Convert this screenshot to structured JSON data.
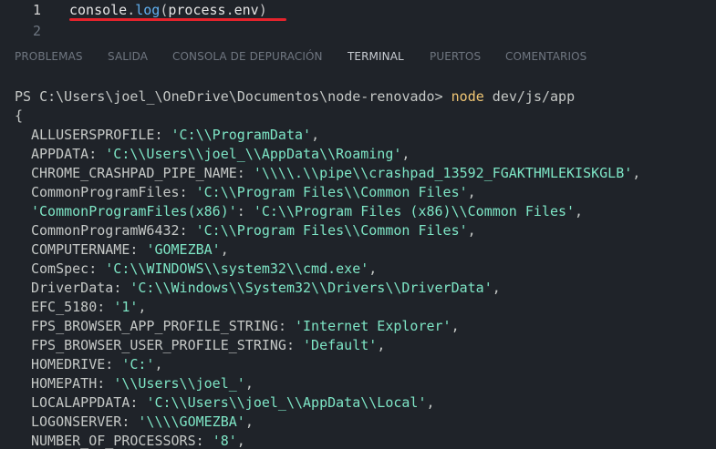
{
  "editor": {
    "lines": [
      {
        "number": "1",
        "obj": "console",
        "dot1": ".",
        "fn": "log",
        "open": "(",
        "arg_obj": "process",
        "dot2": ".",
        "arg_prop": "env",
        "close": ")"
      },
      {
        "number": "2"
      }
    ]
  },
  "panel": {
    "tabs": [
      "PROBLEMAS",
      "SALIDA",
      "CONSOLA DE DEPURACIÓN",
      "TERMINAL",
      "PUERTOS",
      "COMENTARIOS"
    ],
    "active_tab": "TERMINAL"
  },
  "terminal": {
    "prompt": "PS C:\\Users\\joel_\\OneDrive\\Documentos\\node-renovado> ",
    "command": "node",
    "args": " dev/js/app",
    "open_brace": "{",
    "entries": [
      {
        "key": "ALLUSERSPROFILE",
        "value": "'C:\\\\ProgramData'"
      },
      {
        "key": "APPDATA",
        "value": "'C:\\\\Users\\\\joel_\\\\AppData\\\\Roaming'"
      },
      {
        "key": "CHROME_CRASHPAD_PIPE_NAME",
        "value": "'\\\\\\\\.\\\\pipe\\\\crashpad_13592_FGAKTHMLEKISKGLB'"
      },
      {
        "key": "CommonProgramFiles",
        "value": "'C:\\\\Program Files\\\\Common Files'"
      },
      {
        "key": "'CommonProgramFiles(x86)'",
        "value": "'C:\\\\Program Files (x86)\\\\Common Files'",
        "quoted": true
      },
      {
        "key": "CommonProgramW6432",
        "value": "'C:\\\\Program Files\\\\Common Files'"
      },
      {
        "key": "COMPUTERNAME",
        "value": "'GOMEZBA'"
      },
      {
        "key": "ComSpec",
        "value": "'C:\\\\WINDOWS\\\\system32\\\\cmd.exe'"
      },
      {
        "key": "DriverData",
        "value": "'C:\\\\Windows\\\\System32\\\\Drivers\\\\DriverData'"
      },
      {
        "key": "EFC_5180",
        "value": "'1'"
      },
      {
        "key": "FPS_BROWSER_APP_PROFILE_STRING",
        "value": "'Internet Explorer'"
      },
      {
        "key": "FPS_BROWSER_USER_PROFILE_STRING",
        "value": "'Default'"
      },
      {
        "key": "HOMEDRIVE",
        "value": "'C:'"
      },
      {
        "key": "HOMEPATH",
        "value": "'\\\\Users\\\\joel_'"
      },
      {
        "key": "LOCALAPPDATA",
        "value": "'C:\\\\Users\\\\joel_\\\\AppData\\\\Local'"
      },
      {
        "key": "LOGONSERVER",
        "value": "'\\\\\\\\GOMEZBA'"
      },
      {
        "key": "NUMBER_OF_PROCESSORS",
        "value": "'8'"
      }
    ]
  },
  "colors": {
    "background": "#1f2329",
    "function": "#61afef",
    "string": "#7ee6c6",
    "command": "#f0c674",
    "underline": "#e5232c"
  }
}
